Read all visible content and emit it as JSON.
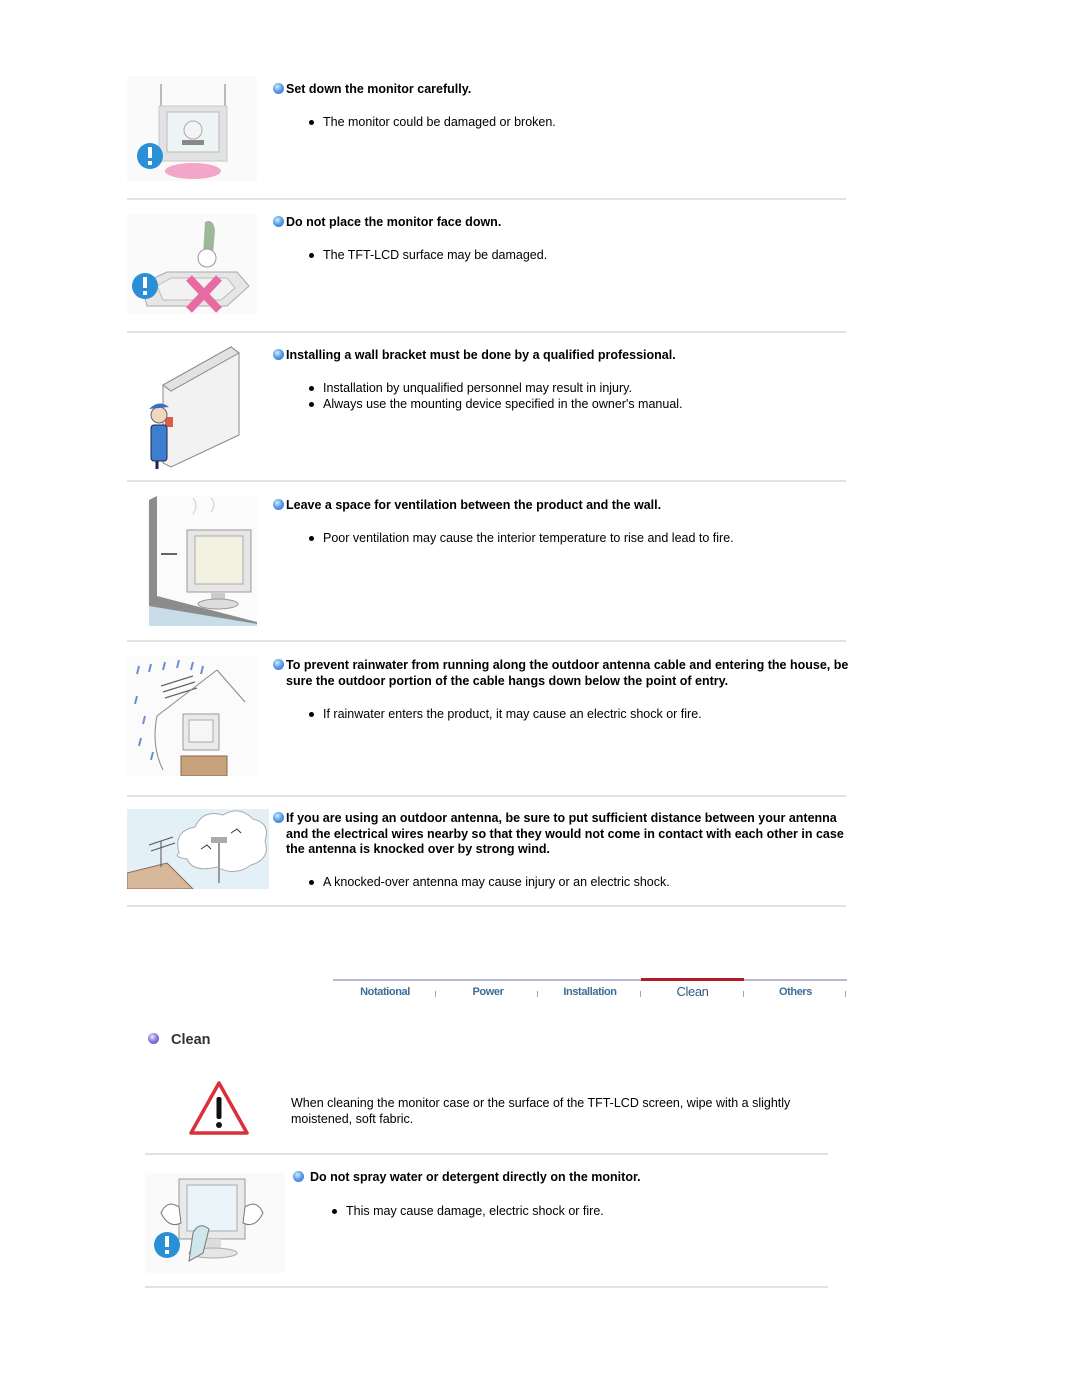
{
  "items": [
    {
      "illustration": "monitor-held-carefully-illustration",
      "title": "Set down the monitor carefully.",
      "points": [
        "The monitor could be damaged or broken."
      ]
    },
    {
      "illustration": "monitor-face-down-prohibited-illustration",
      "title": "Do not place the monitor face down.",
      "points": [
        "The TFT-LCD surface may be damaged."
      ]
    },
    {
      "illustration": "wall-bracket-installer-illustration",
      "title": "Installing a wall bracket must be done by a qualified professional.",
      "points": [
        "Installation by unqualified personnel may result in injury.",
        "Always use the mounting device specified in the owner's manual."
      ]
    },
    {
      "illustration": "ventilation-gap-illustration",
      "title": "Leave a space for ventilation between the product and the wall.",
      "points": [
        "Poor ventilation may cause the interior temperature to rise and lead to fire."
      ]
    },
    {
      "illustration": "rainwater-antenna-cable-illustration",
      "title": "To prevent rainwater from running along the outdoor antenna cable and entering the house, be sure the outdoor portion of the cable hangs down below the point of entry.",
      "points": [
        "If rainwater enters the product, it may cause an electric shock or fire."
      ]
    },
    {
      "illustration": "antenna-power-lines-illustration",
      "title": "If you are using an outdoor antenna, be sure to put sufficient distance between your antenna and the electrical wires nearby so that they would not come in contact with each other in case the antenna is knocked over by strong wind.",
      "points": [
        "A knocked-over antenna may cause injury or an electric shock."
      ]
    }
  ],
  "nav": {
    "tabs": [
      {
        "label": "Notational",
        "active": false
      },
      {
        "label": "Power",
        "active": false
      },
      {
        "label": "Installation",
        "active": false
      },
      {
        "label": "Clean",
        "active": true
      },
      {
        "label": "Others",
        "active": false
      }
    ],
    "active_color": "#b01c24",
    "tab_text_color": "#3b6f95"
  },
  "clean_section": {
    "title": "Clean",
    "intro": "When cleaning the monitor case or the surface of the TFT-LCD screen, wipe with a slightly moistened, soft fabric.",
    "items": [
      {
        "illustration": "spray-on-monitor-prohibited-illustration",
        "title": "Do not spray water or detergent directly on the monitor.",
        "points": [
          "This may cause damage, electric shock or fire."
        ]
      }
    ]
  },
  "colors": {
    "caution_blue": "#2a8fd6",
    "warning_red": "#d9303a",
    "divider": "#e2e2e2"
  }
}
